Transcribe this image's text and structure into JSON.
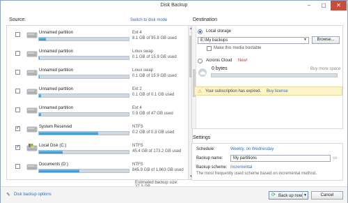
{
  "window": {
    "title": "Disk Backup"
  },
  "source": {
    "label": "Source:",
    "switch_link": "Switch to disk mode",
    "partitions": [
      {
        "name": "Unnamed partition",
        "fs": "Ext 4",
        "size": "8.1 GB of 95.8 GB used",
        "checked": false,
        "fill": 0.08,
        "icon": "hard-drive-icon"
      },
      {
        "name": "Unnamed partition",
        "fs": "Linux swap",
        "size": "0.1 GB of 15.9 GB used",
        "checked": false,
        "fill": 0.01,
        "icon": "hard-drive-icon"
      },
      {
        "name": "Unnamed partition",
        "fs": "Linux swap",
        "size": "0.1 GB of 15.9 GB used",
        "checked": false,
        "fill": 0.01,
        "icon": "hard-drive-icon"
      },
      {
        "name": "Unnamed partition",
        "fs": "Ext 2",
        "size": "0.1 GB of 0.1 GB used",
        "checked": false,
        "fill": 0.02,
        "icon": "hard-drive-icon"
      },
      {
        "name": "Unnamed partition",
        "fs": "Ext 4",
        "size": "0.9 GB of 47 GB used",
        "checked": false,
        "fill": 0.02,
        "icon": "hard-drive-icon"
      },
      {
        "name": "System Reserved",
        "fs": "NTFS",
        "size": "0.2 GB of 0.3 GB used",
        "checked": true,
        "fill": 0.66,
        "icon": "hard-drive-icon"
      },
      {
        "name": "Local Disk (C:)",
        "fs": "NTFS",
        "size": "45.4 GB of 173.2 GB used",
        "checked": true,
        "fill": 0.26,
        "icon": "windows-drive-icon"
      },
      {
        "name": "Documents (D:)",
        "fs": "NTFS",
        "size": "845.9 GB of 1,863 GB used",
        "checked": false,
        "fill": 0.45,
        "icon": "hard-drive-icon"
      }
    ],
    "estimated": "Estimated backup size: 27.3 GB"
  },
  "destination": {
    "label": "Destination",
    "local_label": "Local storage",
    "path_value": "E:\\My backups",
    "browse_label": "Browse...",
    "bootable_label": "Make this media bootable",
    "cloud_label": "Acronis Cloud",
    "cloud_new": "New!",
    "cloud_bytes": "0 bytes",
    "buy_more": "Buy more space",
    "cloud_fill": 0.0,
    "warning_text": "Your subscription has expired.",
    "warning_link": "Buy license"
  },
  "settings": {
    "label": "Settings",
    "schedule_label": "Schedule:",
    "schedule_value": "Weekly, on Wednesday",
    "name_label": "Backup name:",
    "name_value": "My partitions",
    "scheme_label": "Backup scheme:",
    "scheme_value": "Incremental",
    "scheme_desc": "The most frequently used scheme based on incremental method."
  },
  "footer": {
    "options_link": "Disk backup options",
    "backup_button": "Back up now",
    "cancel_button": "Cancel"
  }
}
